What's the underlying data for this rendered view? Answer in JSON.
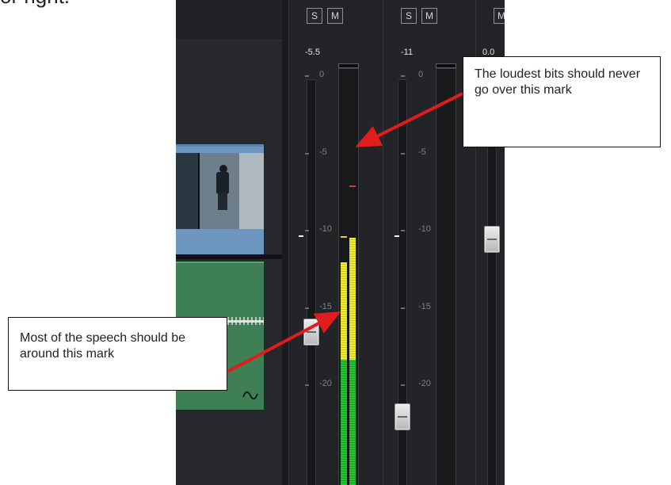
{
  "page": {
    "top_caption": "or right."
  },
  "mixer": {
    "channels": [
      {
        "solo_label": "S",
        "mute_label": "M",
        "level_label": "-5.5",
        "scale": [
          "0",
          "-5",
          "-10",
          "-15",
          "-20"
        ],
        "meter": {
          "left_peak": -10.3,
          "right_peak": -10.8,
          "left_level": -12.0,
          "right_level": -10.4
        },
        "fader_level": -16.5
      },
      {
        "solo_label": "S",
        "mute_label": "M",
        "level_label": "-11",
        "scale": [
          "0",
          "-5",
          "-10",
          "-15",
          "-20"
        ],
        "fader_level": -22.0
      },
      {
        "mute_label": "M",
        "level_label": "0.0",
        "fader_level": -10.5
      }
    ]
  },
  "callouts": {
    "top": "The loudest bits should never go over this mark",
    "bottom": "Most of the speech should be around this mark"
  },
  "colors": {
    "arrow": "#e01c1c",
    "meter_green": "#22c534",
    "meter_yellow": "#f0ea34",
    "meter_red": "#d53b3b"
  }
}
